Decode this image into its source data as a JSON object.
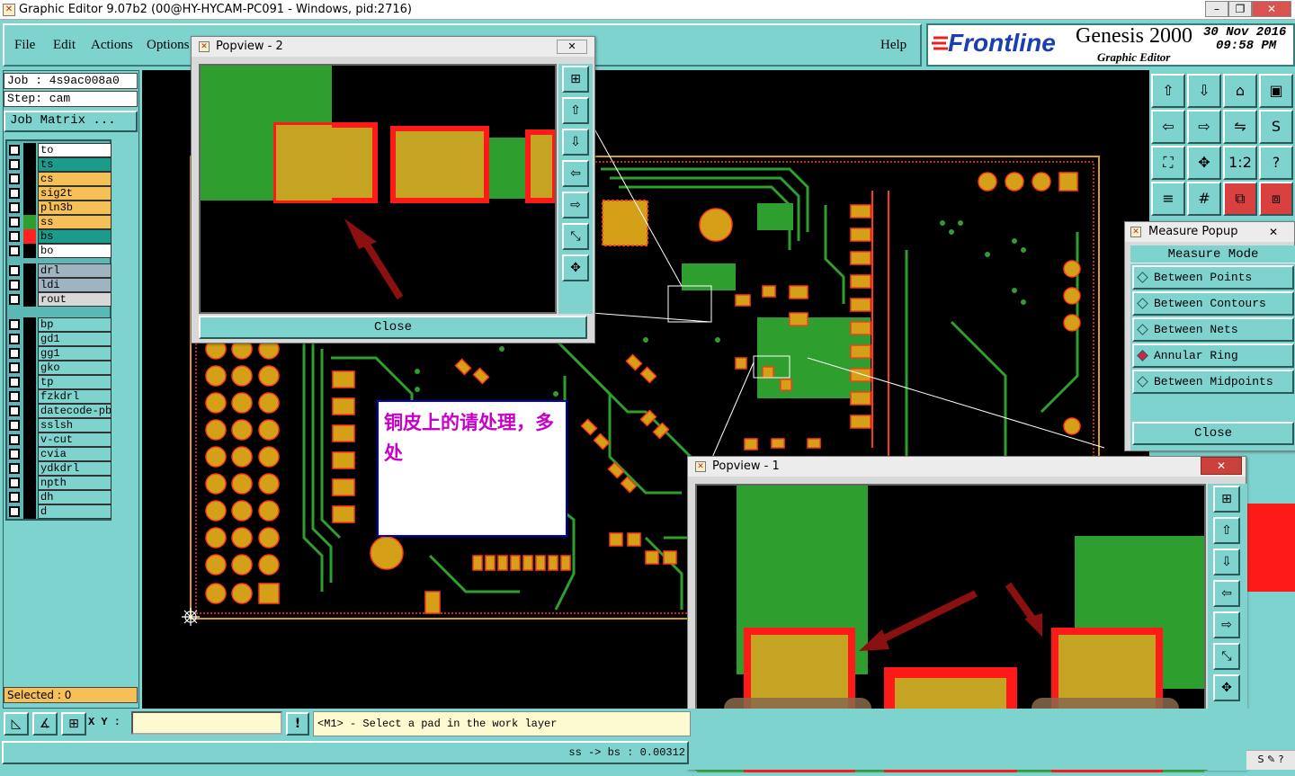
{
  "window": {
    "title": "Graphic Editor 9.07b2 (00@HY-HYCAM-PC091 - Windows, pid:2716)",
    "minimize": "–",
    "restore": "❐",
    "close": "✕"
  },
  "menu": {
    "file": "File",
    "edit": "Edit",
    "actions": "Actions",
    "options": "Options",
    "help": "Help"
  },
  "brand": {
    "logo": "Frontline",
    "product": "Genesis 2000",
    "subtitle": "Graphic Editor",
    "date": "30 Nov 2016",
    "time": "09:58 PM"
  },
  "job": {
    "job_label": "Job : 4s9ac008a0",
    "step_label": "Step: cam",
    "matrix_button": "Job Matrix ..."
  },
  "layers": [
    {
      "name": "to",
      "color": "#ffffff",
      "swatch": "#000000"
    },
    {
      "name": "ts",
      "color": "#1a9b8c",
      "swatch": "#000000"
    },
    {
      "name": "cs",
      "color": "#f5c058",
      "swatch": "#000000"
    },
    {
      "name": "sig2t",
      "color": "#f5c058",
      "swatch": "#000000"
    },
    {
      "name": "pln3b",
      "color": "#f5c058",
      "swatch": "#000000"
    },
    {
      "name": "ss",
      "color": "#f5c058",
      "swatch": "#2e9e2e"
    },
    {
      "name": "bs",
      "color": "#1a9b8c",
      "swatch": "#ff2222"
    },
    {
      "name": "bo",
      "color": "#ffffff",
      "swatch": "#000000"
    },
    {
      "name": "drl",
      "color": "#9fb3c0",
      "swatch": "#000000"
    },
    {
      "name": "ldi",
      "color": "#9fb3c0",
      "swatch": "#000000"
    },
    {
      "name": "rout",
      "color": "#d8d8d8",
      "swatch": "#000000"
    },
    {
      "name": "bp",
      "color": "#7fd3cf",
      "swatch": "#000000"
    },
    {
      "name": "gd1",
      "color": "#7fd3cf",
      "swatch": "#000000"
    },
    {
      "name": "gg1",
      "color": "#7fd3cf",
      "swatch": "#000000"
    },
    {
      "name": "gko",
      "color": "#7fd3cf",
      "swatch": "#000000"
    },
    {
      "name": "tp",
      "color": "#7fd3cf",
      "swatch": "#000000"
    },
    {
      "name": "fzkdrl",
      "color": "#7fd3cf",
      "swatch": "#000000"
    },
    {
      "name": "datecode-pbe",
      "color": "#7fd3cf",
      "swatch": "#000000"
    },
    {
      "name": "sslsh",
      "color": "#7fd3cf",
      "swatch": "#000000"
    },
    {
      "name": "v-cut",
      "color": "#7fd3cf",
      "swatch": "#000000"
    },
    {
      "name": "cvia",
      "color": "#7fd3cf",
      "swatch": "#000000"
    },
    {
      "name": "ydkdrl",
      "color": "#7fd3cf",
      "swatch": "#000000"
    },
    {
      "name": "npth",
      "color": "#7fd3cf",
      "swatch": "#000000"
    },
    {
      "name": "dh",
      "color": "#7fd3cf",
      "swatch": "#000000"
    },
    {
      "name": "d",
      "color": "#7fd3cf",
      "swatch": "#000000"
    }
  ],
  "selected": "Selected : 0",
  "popview2": {
    "title": "Popview - 2",
    "close": "Close"
  },
  "popview1": {
    "title": "Popview - 1"
  },
  "measure": {
    "title": "Measure Popup",
    "header": "Measure Mode",
    "options": [
      "Between Points",
      "Between Contours",
      "Between Nets",
      "Annular Ring",
      "Between Midpoints"
    ],
    "selected_index": 3,
    "close": "Close"
  },
  "note": {
    "text": "铜皮上的请处理，多处"
  },
  "status": {
    "xy_label": "X Y :",
    "xy_value": "",
    "prompt": "<M1> - Select a pad in the work layer",
    "layer_info": "ss -> bs : 0.00312"
  },
  "colors": {
    "copper": "#d4a017",
    "trace": "#2e9e2e",
    "mask": "#ff1a1a",
    "panel": "#7fd3cf"
  }
}
